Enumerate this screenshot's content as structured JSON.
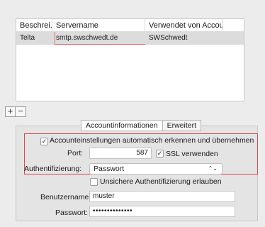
{
  "table": {
    "headers": [
      "Beschrei...",
      "Servername",
      "Verwendet von Account"
    ],
    "row": {
      "description": "Telta",
      "server": "smtp.swschwedt.de",
      "account": "SWSchwedt"
    }
  },
  "list_buttons": {
    "add": "+",
    "remove": "−"
  },
  "tabs": [
    "Accountinformationen",
    "Erweitert"
  ],
  "settings": {
    "auto_detect_label": "Accounteinstellungen automatisch erkennen und übernehmen",
    "auto_detect_checked": true,
    "port_label": "Port:",
    "port_value": "587",
    "ssl_label": "SSL verwenden",
    "ssl_checked": true,
    "auth_label": "Authentifizierung:",
    "auth_value": "Passwort",
    "insecure_label": "Unsichere Authentifizierung erlauben",
    "insecure_checked": false,
    "username_label": "Benutzername:",
    "username_value": "muster",
    "password_label": "Passwort:",
    "password_value": "••••••••••••••"
  },
  "colors": {
    "highlight": "#d9484f"
  },
  "icons": {
    "checkmark": "✓",
    "select_arrows": "⌃⌄"
  }
}
